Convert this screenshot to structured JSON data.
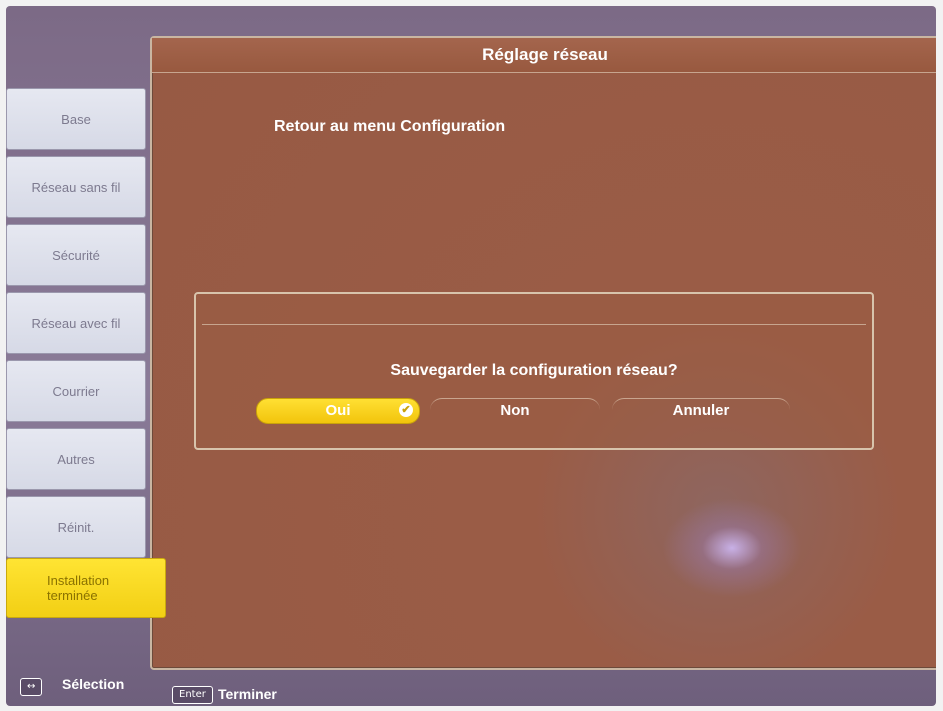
{
  "header": {
    "title": "Réglage réseau"
  },
  "main": {
    "back_link": "Retour au menu Configuration"
  },
  "sidebar": {
    "items": [
      {
        "label": "Base"
      },
      {
        "label": "Réseau sans fil"
      },
      {
        "label": "Sécurité"
      },
      {
        "label": "Réseau avec fil"
      },
      {
        "label": "Courrier"
      },
      {
        "label": "Autres"
      },
      {
        "label": "Réinit."
      },
      {
        "label": "Installation terminée",
        "active": true
      }
    ]
  },
  "dialog": {
    "message": "Sauvegarder la configuration réseau?",
    "buttons": {
      "yes": "Oui",
      "no": "Non",
      "cancel": "Annuler"
    },
    "selected": "Oui"
  },
  "footer": {
    "select_key": "↔",
    "select_label": "Sélection",
    "enter_key": "Enter",
    "enter_label": "Terminer"
  },
  "colors": {
    "panel_bg": "#975a44",
    "accent_yellow": "#f2cf14",
    "sidebar_bg": "#e0e2ec",
    "frame_bg": "#7c6a86"
  },
  "icons": {
    "selected_check": "check-circle-icon"
  }
}
